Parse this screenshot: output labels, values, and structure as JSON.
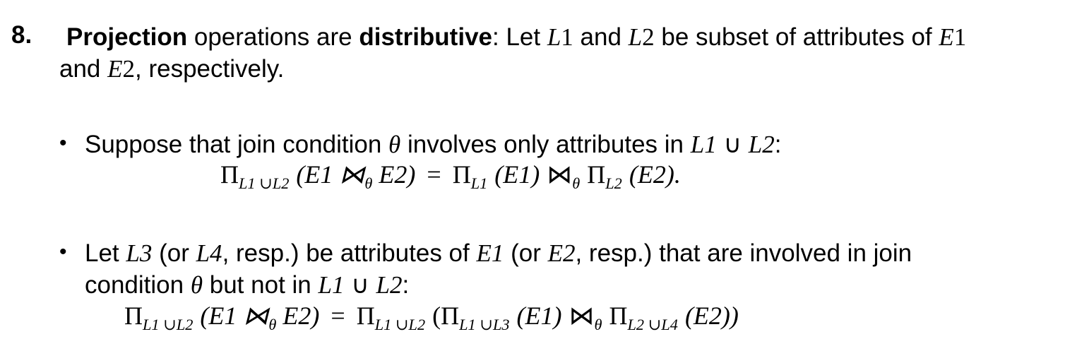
{
  "item": {
    "number": "8.",
    "w_projection": "Projection",
    "t_ops_are": " operations are ",
    "w_distributive": "distributive",
    "t_let": ": Let ",
    "L1": "L",
    "n1": "1",
    "t_and": " and ",
    "L2": "L",
    "n2": "2",
    "t_subset": " be subset of attributes of ",
    "E1": "E",
    "e1": "1",
    "t_and2": " and ",
    "E2": "E",
    "e2": "2",
    "t_resp": ", respectively."
  },
  "bullet1": {
    "symbol": "•",
    "text_a": "Suppose that join condition ",
    "theta": "θ",
    "text_b": " involves only attributes in ",
    "L1": "L1",
    "cup": "∪",
    "L2": "L2",
    "colon": ":",
    "formula": {
      "pi": "Π",
      "sub_lhs": "L1 ∪L2",
      "lhs_args": "(E1 ⋈",
      "theta": "θ",
      "lhs_tail": " E2)",
      "eq": "=",
      "pi_a": "Π",
      "sub_a": "L1",
      "arg_a": "(E1)",
      "join": "⋈",
      "theta_b": "θ",
      "pi_b": "Π",
      "sub_b": "L2",
      "arg_b": "(E2).",
      "tail": ""
    }
  },
  "bullet2": {
    "symbol": "•",
    "line1_a": "Let ",
    "L3": "L3",
    "line1_b": " (or ",
    "L4": "L4",
    "line1_c": ", resp.) be attributes of ",
    "E1": "E1",
    "line1_d": " (or ",
    "E2": "E2",
    "line1_e": ", resp.) that are involved in join",
    "line2_a": "condition ",
    "theta": "θ",
    "line2_b": " but not in ",
    "L1": "L1",
    "cup": "∪",
    "L2": "L2",
    "colon": ":",
    "formula": {
      "pi": "Π",
      "sub_lhs": "L1 ∪L2",
      "lhs_args": "(E1 ⋈",
      "theta": "θ",
      "lhs_tail": " E2)",
      "eq": "=",
      "pi_outer": "Π",
      "sub_outer": "L1 ∪L2",
      "open": "(Π",
      "sub_a": "L1 ∪L3",
      "arg_a": "(E1)",
      "join": "⋈",
      "theta_b": "θ",
      "pi_b": "Π",
      "sub_b": "L2 ∪L4",
      "arg_b": "(E2))"
    }
  }
}
